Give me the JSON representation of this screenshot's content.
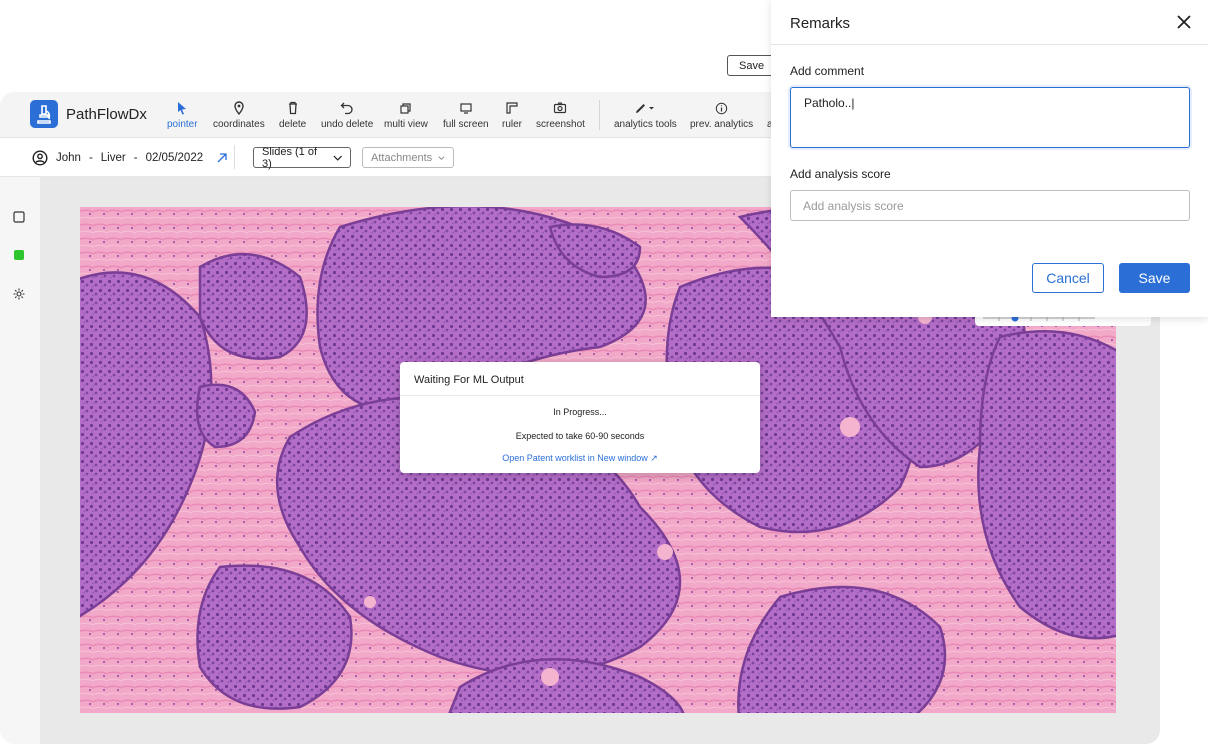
{
  "brand": {
    "name": "PathFlowDx"
  },
  "toolbar": {
    "tools": [
      {
        "label": "pointer",
        "icon": "pointer-icon"
      },
      {
        "label": "coordinates",
        "icon": "pin-icon"
      },
      {
        "label": "delete",
        "icon": "trash-icon"
      },
      {
        "label": "undo delete",
        "icon": "undo-icon"
      },
      {
        "label": "multi view",
        "icon": "multi-view-icon"
      },
      {
        "label": "full screen",
        "icon": "full-screen-icon"
      },
      {
        "label": "ruler",
        "icon": "ruler-icon"
      },
      {
        "label": "screenshot",
        "icon": "camera-icon"
      },
      {
        "label": "analytics tools",
        "icon": "pen-icon"
      },
      {
        "label": "prev. analytics",
        "icon": "info-icon"
      },
      {
        "label": "a",
        "icon": ""
      }
    ],
    "accent": "#2b6fd6"
  },
  "patient": {
    "name": "John",
    "organ": "Liver",
    "date": "02/05/2022"
  },
  "subbar": {
    "sep": "-",
    "slides_label": "Slides (1 of 3)",
    "attachments_label": "Attachments",
    "save_label": "Save"
  },
  "ml_dialog": {
    "title": "Waiting For ML Output",
    "status": "In Progress...",
    "eta": "Expected to take 60-90 seconds",
    "link": "Open Patent worklist in New window ↗"
  },
  "remarks": {
    "title": "Remarks",
    "comment_label": "Add comment",
    "comment_value": "Patholo..|",
    "score_label": "Add analysis score",
    "score_placeholder": "Add analysis score",
    "cancel_label": "Cancel",
    "save_label": "Save"
  }
}
